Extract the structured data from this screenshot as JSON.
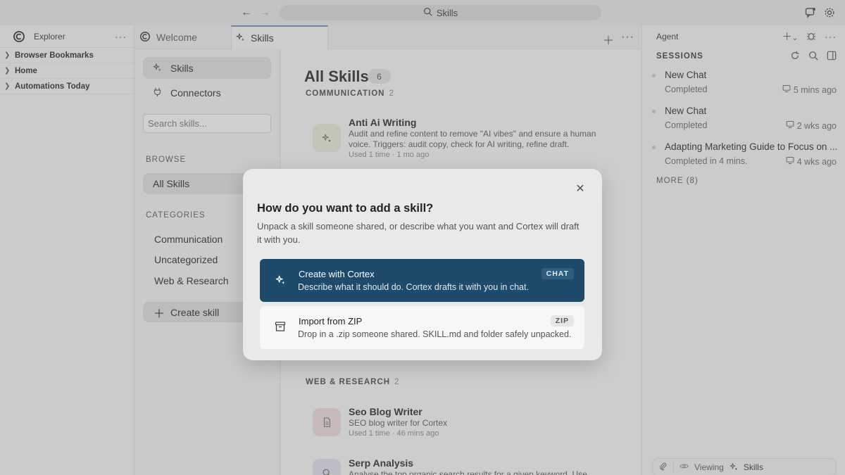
{
  "titlebar": {
    "back": "←",
    "forward": "→",
    "search_label": "Skills"
  },
  "explorer": {
    "title": "Explorer",
    "more": "···",
    "items": [
      {
        "label": "Browser Bookmarks"
      },
      {
        "label": "Home"
      },
      {
        "label": "Automations Today"
      }
    ]
  },
  "tabs": [
    {
      "label": "Welcome"
    },
    {
      "label": "Skills"
    }
  ],
  "skills_nav": {
    "items": [
      {
        "label": "Skills"
      },
      {
        "label": "Connectors"
      }
    ],
    "search_placeholder": "Search skills...",
    "browse_label": "BROWSE",
    "all_skills": "All Skills",
    "categories_label": "CATEGORIES",
    "categories": [
      "Communication",
      "Uncategorized",
      "Web & Research"
    ],
    "create_label": "Create skill"
  },
  "main": {
    "title": "All Skills",
    "count": "6",
    "groups": [
      {
        "label": "COMMUNICATION",
        "count": "2"
      },
      {
        "label": "WEB & RESEARCH",
        "count": "2"
      }
    ],
    "skills": [
      {
        "name": "Anti Ai Writing",
        "desc": "Audit and refine content to remove \"AI vibes\" and ensure a human voice. Triggers: audit copy, check for AI writing, refine draft.",
        "meta": "Used 1 time · 1 mo ago"
      },
      {
        "name": "Seo Blog Writer",
        "desc": "SEO blog writer for Cortex",
        "meta": "Used 1 time · 46 mins ago"
      },
      {
        "name": "Serp Analysis",
        "desc": "Analyse the top organic search results for a given keyword. Use",
        "meta": ""
      }
    ]
  },
  "agent": {
    "title": "Agent",
    "sessions_label": "SESSIONS",
    "sessions": [
      {
        "title": "New Chat",
        "status": "Completed",
        "time": "5 mins ago"
      },
      {
        "title": "New Chat",
        "status": "Completed",
        "time": "2 wks ago"
      },
      {
        "title": "Adapting Marketing Guide to Focus on ...",
        "status": "Completed in 4 mins.",
        "time": "4 wks ago"
      }
    ],
    "more_label": "MORE (8)",
    "viewing_label": "Viewing",
    "viewing_target": "Skills"
  },
  "modal": {
    "title": "How do you want to add a skill?",
    "subtitle": "Unpack a skill someone shared, or describe what you want and Cortex will draft it with you.",
    "options": [
      {
        "title": "Create with Cortex",
        "desc": "Describe what it should do. Cortex drafts it with you in chat.",
        "tag": "CHAT"
      },
      {
        "title": "Import from ZIP",
        "desc": "Drop in a .zip someone shared. SKILL.md and folder safely unpacked.",
        "tag": "ZIP"
      }
    ]
  },
  "colors": {
    "accent": "#1e4a6c",
    "overlay": "#787878"
  }
}
